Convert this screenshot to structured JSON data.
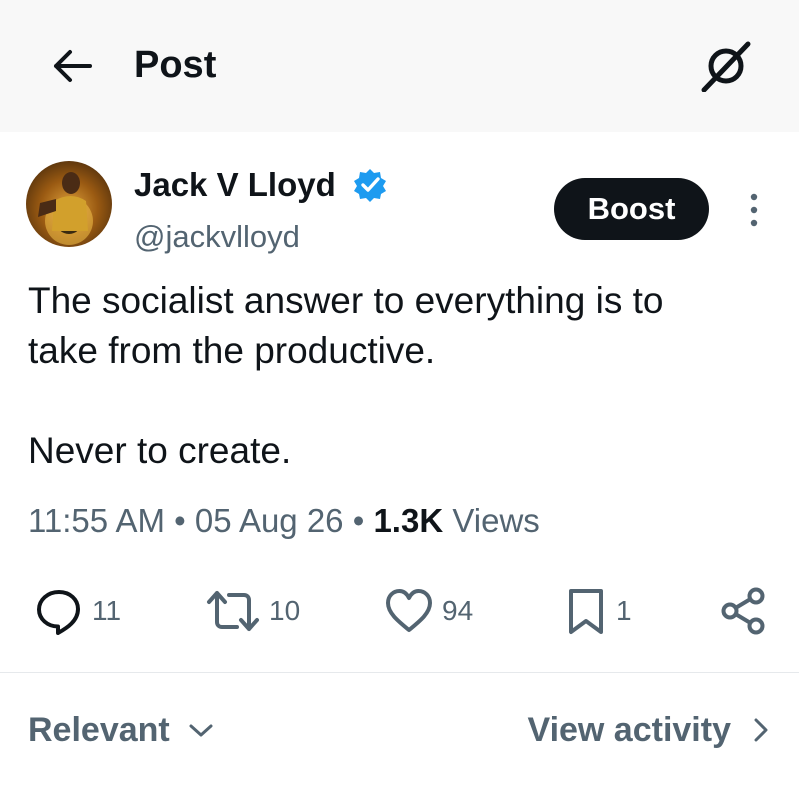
{
  "header": {
    "title": "Post",
    "back_icon": "arrow-left-icon",
    "grok_icon": "grok-icon"
  },
  "post": {
    "author_name": "Jack V Lloyd",
    "author_handle": "@jackvlloyd",
    "verified_color": "#1d9bf0",
    "boost_label": "Boost",
    "text_lines": [
      "The socialist answer to everything is to",
      "take from the productive.",
      "",
      "Never to create."
    ],
    "time": "11:55 AM",
    "separator": "•",
    "date": "05 Aug 26",
    "views_count": "1.3K",
    "views_label": "Views"
  },
  "actions": {
    "replies": "11",
    "reposts": "10",
    "likes": "94",
    "bookmarks": "1"
  },
  "footer": {
    "sort_label": "Relevant",
    "activity_label": "View activity"
  }
}
